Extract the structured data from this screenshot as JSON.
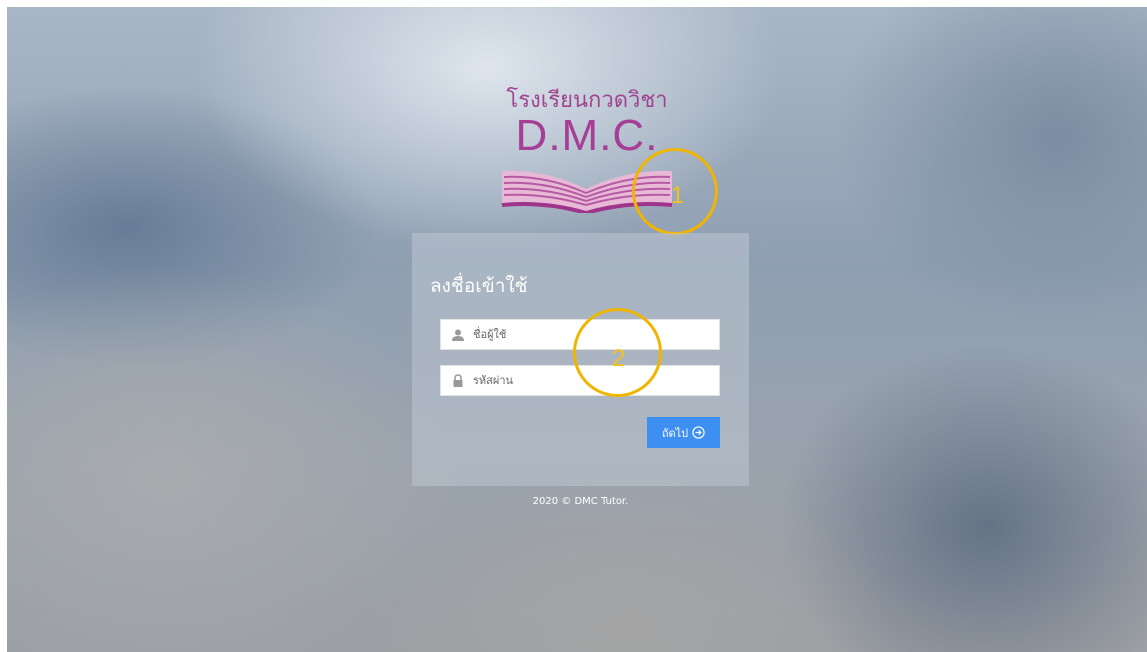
{
  "logo": {
    "thai_name": "โรงเรียนกวดวิชา",
    "abbrev": "D.M.C."
  },
  "annotations": [
    "1",
    "2"
  ],
  "login": {
    "title": "ลงชื่อเข้าใช้",
    "username_placeholder": "ชื่อผู้ใช้",
    "password_placeholder": "รหัสผ่าน",
    "next_label": "ถัดไป",
    "username_icon": "user-icon",
    "password_icon": "lock-icon",
    "next_icon": "circle-arrow-right-icon"
  },
  "footer": {
    "copyright": "2020 © DMC Tutor."
  },
  "colors": {
    "accent": "#3d8ff2",
    "brand": "#a63d96",
    "annotation": "#f0b500"
  }
}
